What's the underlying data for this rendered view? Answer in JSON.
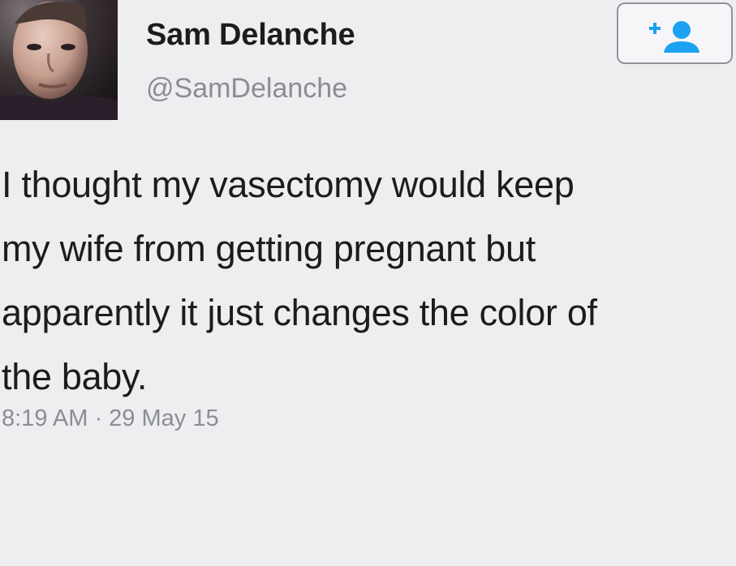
{
  "tweet": {
    "author": {
      "display_name": "Sam Delanche",
      "handle": "@SamDelanche"
    },
    "follow_button": {
      "icon": "add-user-icon",
      "accent_color": "#1da1f2"
    },
    "text": "I thought my vasectomy would keep\nmy wife from getting pregnant but\napparently it just changes the color of\nthe baby.",
    "timestamp": "8:19 AM · 29 May 15"
  }
}
